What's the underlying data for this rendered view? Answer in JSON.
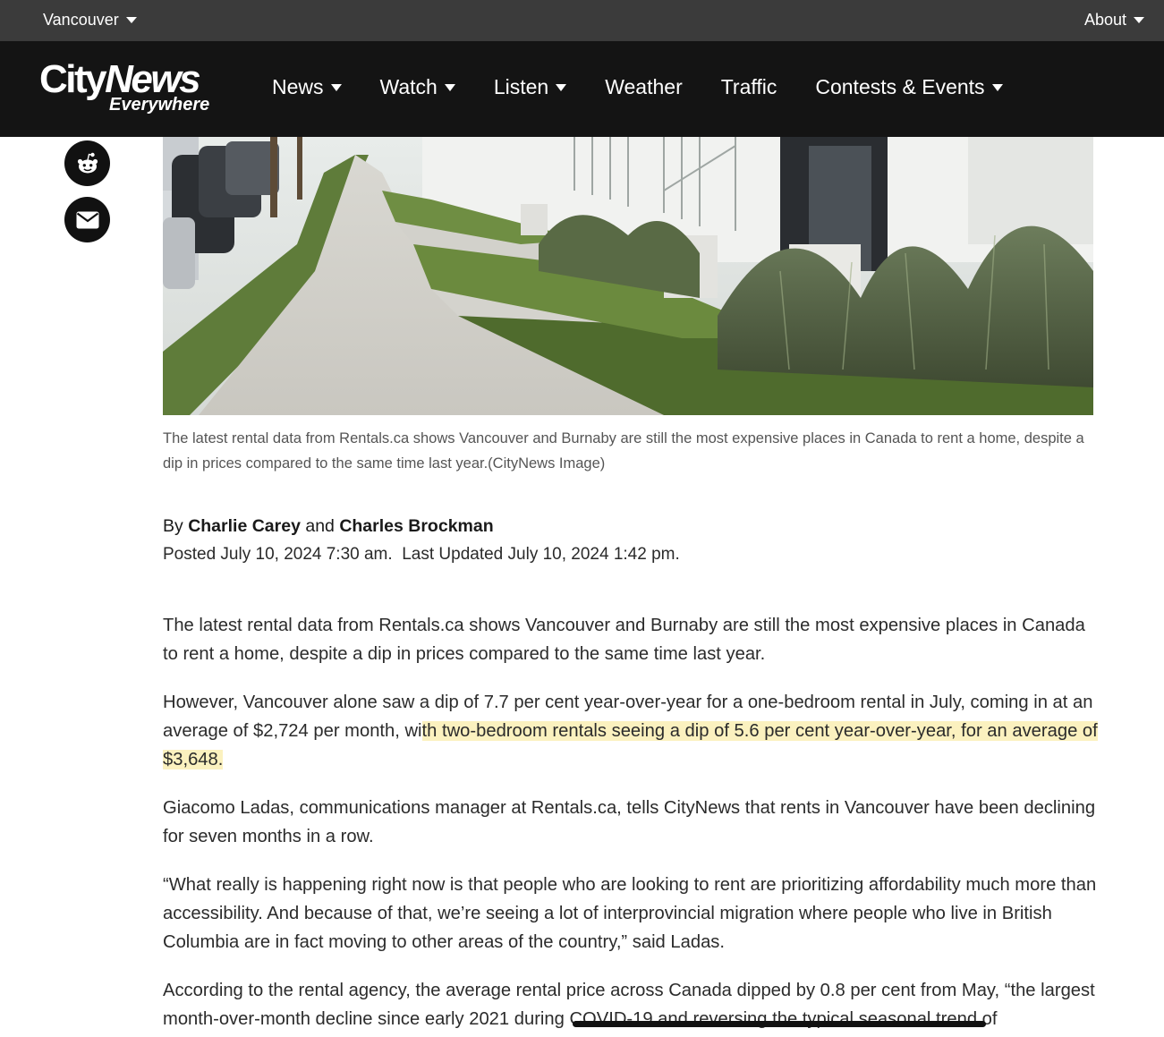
{
  "topbar": {
    "location_label": "Vancouver",
    "about_label": "About"
  },
  "brand": {
    "logo_line1_city": "City",
    "logo_line1_news": "News",
    "logo_line2": "Everywhere"
  },
  "nav": {
    "items": [
      {
        "label": "News",
        "has_dropdown": true
      },
      {
        "label": "Watch",
        "has_dropdown": true
      },
      {
        "label": "Listen",
        "has_dropdown": true
      },
      {
        "label": "Weather",
        "has_dropdown": false
      },
      {
        "label": "Traffic",
        "has_dropdown": false
      },
      {
        "label": "Contests & Events",
        "has_dropdown": true
      }
    ]
  },
  "share": {
    "buttons": [
      "reddit-icon",
      "envelope-icon"
    ]
  },
  "image": {
    "caption": "The latest rental data from Rentals.ca shows Vancouver and Burnaby are still the most expensive places in Canada to rent a home, despite a dip in prices compared to the same time last year.(CityNews Image)"
  },
  "byline": {
    "by": "By",
    "author1": "Charlie Carey",
    "and": "and",
    "author2": "Charles Brockman",
    "posted": "Posted July 10, 2024 7:30 am.  Last Updated July 10, 2024 1:42 pm."
  },
  "article": {
    "p1": "The latest rental data from Rentals.ca shows Vancouver and Burnaby are still the most expensive places in Canada to rent a home, despite a dip in prices compared to the same time last year.",
    "p2_before": "However, Vancouver alone saw a dip of 7.7 per cent year-over-year for a one-bedroom rental in July, coming in at an average of $2,724 per month, wi",
    "p2_highlight": "th two-bedroom rentals seeing a dip of 5.6 per cent year-over-year, for an average of $3,648.",
    "p3": "Giacomo Ladas, communications manager at Rentals.ca, tells CityNews that rents in Vancouver have been declining for seven months in a row.",
    "p4": "“What really is happening right now is that people who are looking to rent are prioritizing affordability much more than accessibility. And because of that, we’re seeing a lot of interprovincial migration where people who live in British Columbia are in fact moving to other areas of the country,” said Ladas.",
    "p5": "According to the rental agency, the average rental price across Canada dipped by 0.8 per cent from May, “the largest month-over-month decline since early 2021 during COVID-19 and reversing the typical seasonal trend of"
  },
  "colors": {
    "topbar_bg": "#3b3b3b",
    "navbar_bg": "#141414",
    "highlight": "#fbf1bf"
  }
}
